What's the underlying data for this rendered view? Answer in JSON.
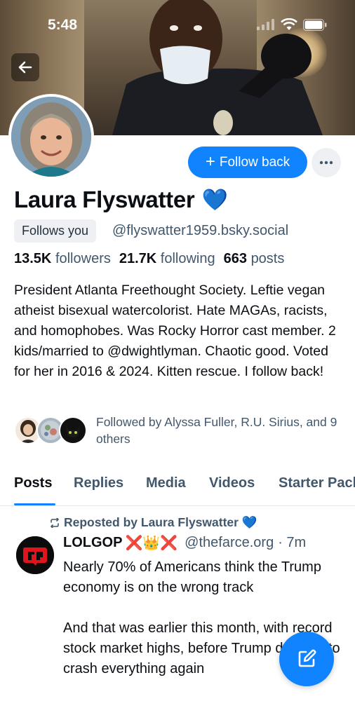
{
  "status_bar": {
    "time": "5:48"
  },
  "profile": {
    "display_name": "Laura Flyswatter",
    "name_emoji": "💙",
    "follows_you_badge": "Follows you",
    "handle": "@flyswatter1959.bsky.social",
    "followers_count": "13.5K",
    "followers_label": "followers",
    "following_count": "21.7K",
    "following_label": "following",
    "posts_count": "663",
    "posts_label": "posts",
    "bio": "President Atlanta Freethought Society. Leftie vegan atheist bisexual watercolorist. Hate MAGAs, racists, and homophobes. Was Rocky Horror cast member. 2 kids/married to @dwightlyman. Chaotic good. Voted for her in 2016 & 2024. Kitten rescue. I follow back!",
    "followed_by": "Followed by Alyssa Fuller, R.U. Sirius, and 9 others"
  },
  "actions": {
    "follow_back_label": "Follow back",
    "more_icon": "ellipsis-icon",
    "back_icon": "arrow-left-icon",
    "compose_icon": "compose-icon"
  },
  "tabs": [
    {
      "label": "Posts",
      "active": true
    },
    {
      "label": "Replies",
      "active": false
    },
    {
      "label": "Media",
      "active": false
    },
    {
      "label": "Videos",
      "active": false
    },
    {
      "label": "Starter Packs",
      "active": false
    }
  ],
  "post": {
    "repost_label": "Reposted by Laura Flyswatter 💙",
    "author": "LOLGOP",
    "author_emojis": "❌👑❌",
    "handle": "@thefarce.org",
    "time": "· 7m",
    "text": "Nearly 70% of Americans think the Trump economy is on the wrong track\n\nAnd that was earlier this month, with record stock market highs, before Trump decided to crash everything again"
  },
  "colors": {
    "accent": "#1083fe",
    "secondary_text": "#42576c",
    "chip_bg": "#eef0f3"
  }
}
